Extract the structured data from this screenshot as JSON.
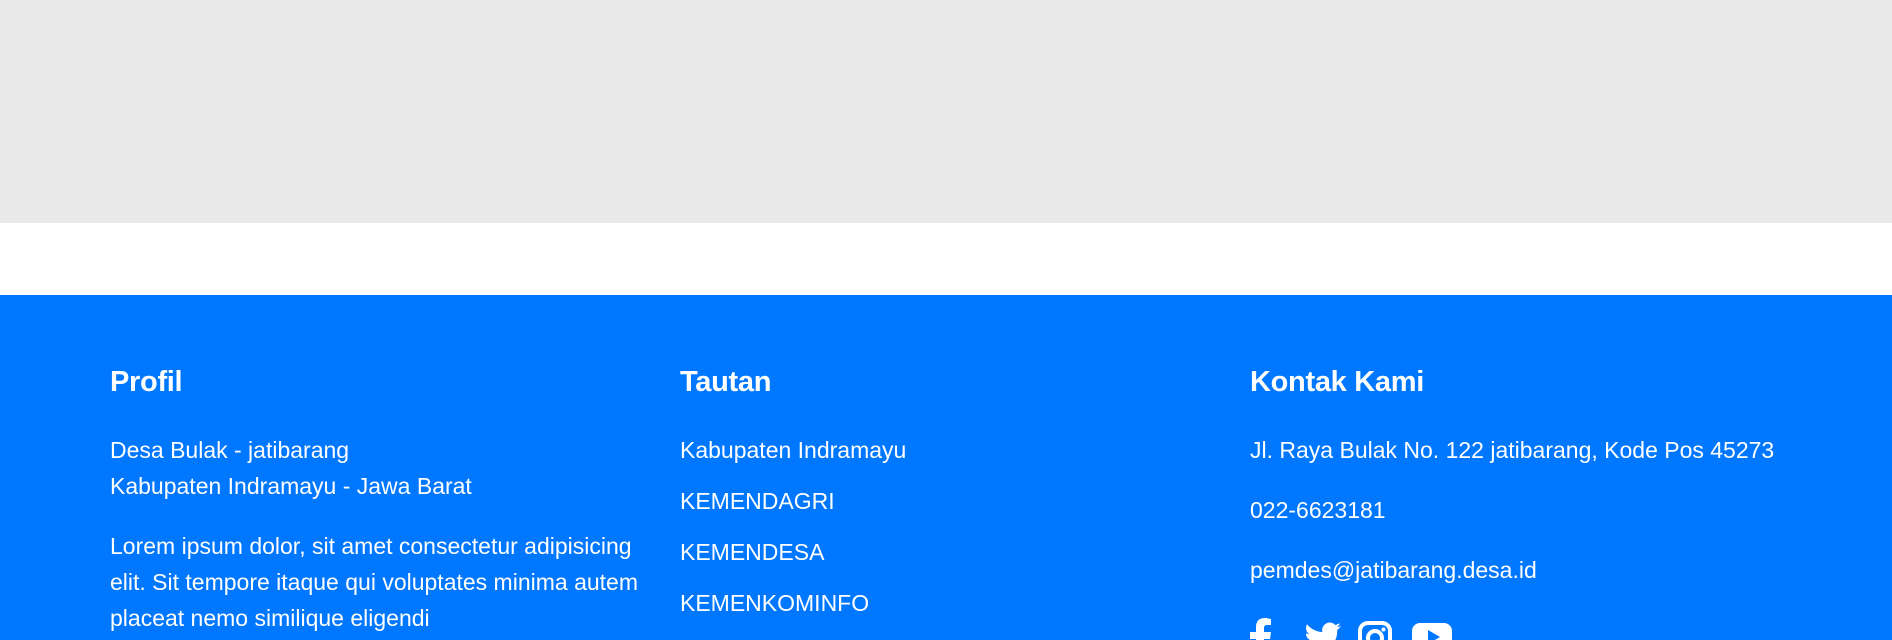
{
  "footer": {
    "profil": {
      "heading": "Profil",
      "line1": "Desa Bulak - jatibarang",
      "line2": "Kabupaten Indramayu - Jawa Barat",
      "description": "Lorem ipsum dolor, sit amet consectetur adipisicing elit. Sit tempore itaque qui voluptates minima autem placeat nemo similique eligendi"
    },
    "tautan": {
      "heading": "Tautan",
      "links": [
        "Kabupaten Indramayu",
        "KEMENDAGRI",
        "KEMENDESA",
        "KEMENKOMINFO"
      ]
    },
    "kontak": {
      "heading": "Kontak Kami",
      "address": "Jl. Raya Bulak No. 122 jatibarang, Kode Pos 45273",
      "phone": "022-6623181",
      "email": "pemdes@jatibarang.desa.id",
      "social_icons": [
        "facebook-icon",
        "twitter-icon",
        "instagram-icon",
        "youtube-icon"
      ]
    }
  },
  "colors": {
    "footer_bg": "#0077ff",
    "top_band": "#e9e9e9",
    "text": "#ffffff"
  }
}
